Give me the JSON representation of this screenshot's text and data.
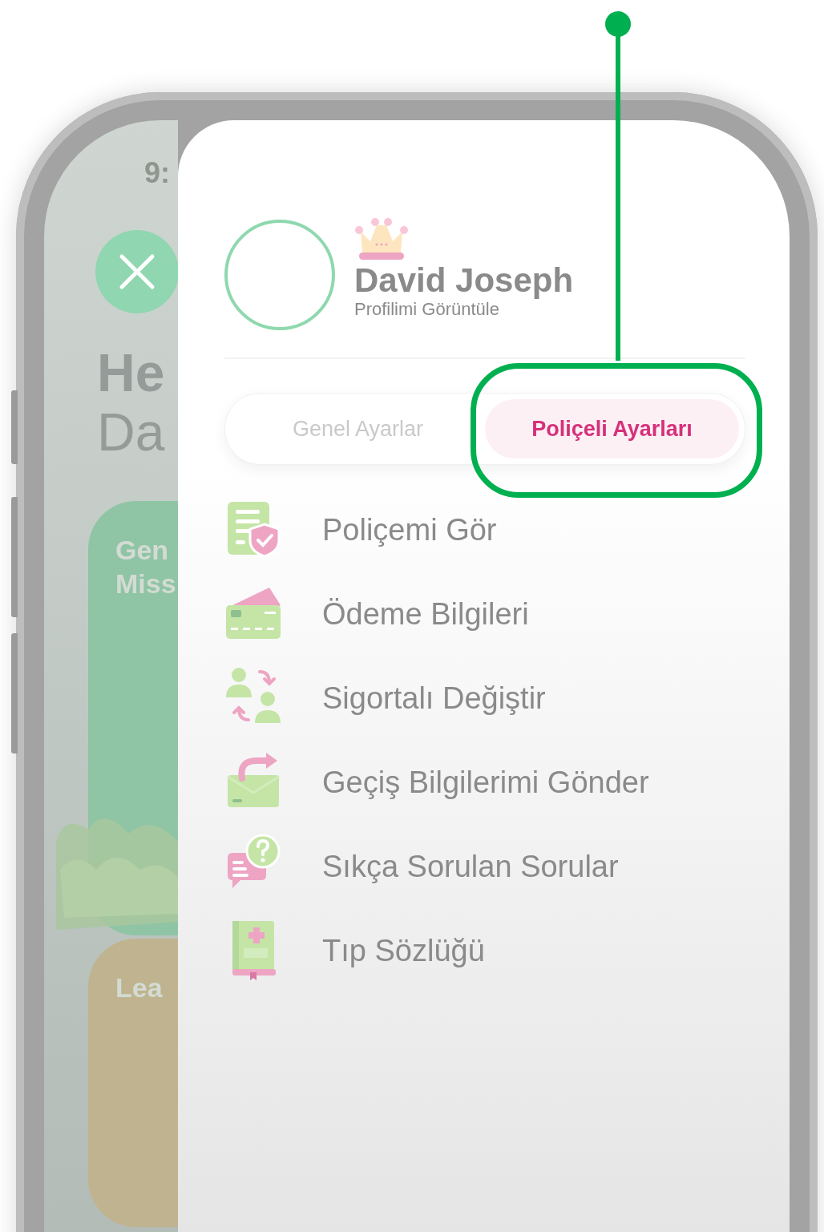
{
  "status_bar": {
    "time": "9:"
  },
  "background_screen": {
    "heading_bold": "He",
    "heading_light": "Da",
    "cards": [
      {
        "title_lines": [
          "Gen",
          "Miss"
        ],
        "color": "#8fc5a5"
      },
      {
        "title_lines": [
          "Lea"
        ],
        "color": "#bfb48f"
      }
    ]
  },
  "drawer": {
    "profile": {
      "name": "David Joseph",
      "link": "Profilimi Görüntüle"
    },
    "tabs": [
      {
        "label": "Genel Ayarlar",
        "selected": false
      },
      {
        "label": "Poliçeli Ayarları",
        "selected": true
      }
    ],
    "menu": [
      {
        "label": "Poliçemi Gör",
        "kind": "policy"
      },
      {
        "label": "Ödeme Bilgileri",
        "kind": "card"
      },
      {
        "label": "Sigortalı Değiştir",
        "kind": "swap"
      },
      {
        "label": "Geçiş Bilgilerimi Gönder",
        "kind": "mail"
      },
      {
        "label": "Sıkça Sorulan Sorular",
        "kind": "faq"
      },
      {
        "label": "Tıp Sözlüğü",
        "kind": "book"
      }
    ]
  }
}
